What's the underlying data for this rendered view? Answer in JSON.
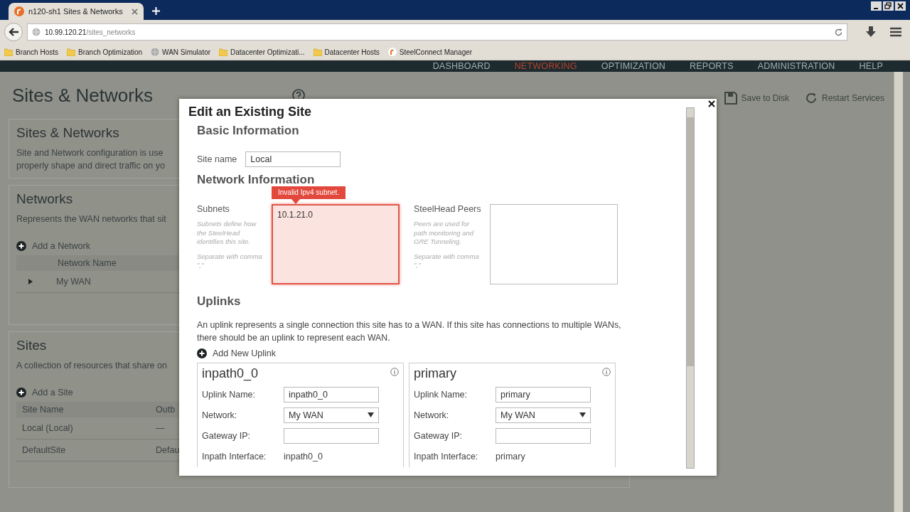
{
  "browser": {
    "tab_title": "n120-sh1 Sites & Networks",
    "url_host": "10.99.120.21",
    "url_path": "/sites_networks",
    "bookmarks": [
      {
        "label": "Branch Hosts",
        "kind": "folder"
      },
      {
        "label": "Branch Optimization",
        "kind": "folder"
      },
      {
        "label": "WAN Simulator",
        "kind": "globe"
      },
      {
        "label": "Datacenter Optimizati...",
        "kind": "folder"
      },
      {
        "label": "Datacenter Hosts",
        "kind": "folder"
      },
      {
        "label": "SteelConnect Manager",
        "kind": "logo"
      }
    ]
  },
  "nav": [
    {
      "label": "DASHBOARD",
      "selected": false
    },
    {
      "label": "NETWORKING",
      "selected": true
    },
    {
      "label": "OPTIMIZATION",
      "selected": false
    },
    {
      "label": "REPORTS",
      "selected": false
    },
    {
      "label": "ADMINISTRATION",
      "selected": false
    },
    {
      "label": "HELP",
      "selected": false
    }
  ],
  "page": {
    "title": "Sites & Networks",
    "actions": [
      {
        "label": "Save to Disk",
        "kind": "save",
        "disabled": true
      },
      {
        "label": "Restart Services",
        "kind": "restart",
        "disabled": true
      }
    ],
    "intro": {
      "title": "Sites & Networks",
      "lines": [
        "Site and Network configuration is use",
        "properly shape and direct traffic on yo"
      ]
    },
    "networks": {
      "title": "Networks",
      "description": "Represents the WAN networks that sit",
      "add_label": "Add a Network",
      "columns": [
        "Network Name"
      ],
      "rows": [
        {
          "cells": [
            "My WAN"
          ],
          "expanded": false
        }
      ]
    },
    "sites": {
      "title": "Sites",
      "description": "A collection of resources that share on",
      "add_label": "Add a Site",
      "columns": [
        "Site Name",
        "Outb"
      ],
      "rows": [
        {
          "cells": [
            "Local (Local)",
            "—"
          ]
        },
        {
          "cells": [
            "DefaultSite",
            "Defau"
          ]
        }
      ]
    }
  },
  "dialog": {
    "title": "Edit an Existing Site",
    "basic": {
      "heading": "Basic Information",
      "site_name_label": "Site name",
      "site_name_value": "Local"
    },
    "network": {
      "heading": "Network Information",
      "fields": [
        {
          "label": "Subnets",
          "help": [
            "Subnets define how the SteelHead identifies this site.",
            "Separate with comma \",\""
          ],
          "value": "10.1.21.0",
          "invalid": true,
          "error": "Invalid Ipv4 subnet."
        },
        {
          "label": "SteelHead Peers",
          "help": [
            "Peers are used for path monitoring and GRE Tunneling.",
            "Separate with comma \",\""
          ],
          "invalid": false
        }
      ]
    },
    "uplinks": {
      "heading": "Uplinks",
      "description": "An uplink represents a single connection this site has to a WAN. If this site has connections to multiple WANs, there should be an uplink to represent each WAN.",
      "add_label": "Add New Uplink",
      "cards": [
        {
          "title": "inpath0_0",
          "fields": [
            {
              "kind": "input",
              "label": "Uplink Name:",
              "value": "inpath0_0"
            },
            {
              "kind": "select",
              "label": "Network:",
              "value": "My WAN"
            },
            {
              "kind": "input",
              "label": "Gateway IP:"
            },
            {
              "kind": "text",
              "label": "Inpath Interface:",
              "value": "inpath0_0"
            }
          ]
        },
        {
          "title": "primary",
          "fields": [
            {
              "kind": "input",
              "label": "Uplink Name:",
              "value": "primary"
            },
            {
              "kind": "select",
              "label": "Network:",
              "value": "My WAN"
            },
            {
              "kind": "input",
              "label": "Gateway IP:"
            },
            {
              "kind": "text",
              "label": "Inpath Interface:",
              "value": "primary"
            }
          ]
        }
      ]
    }
  }
}
